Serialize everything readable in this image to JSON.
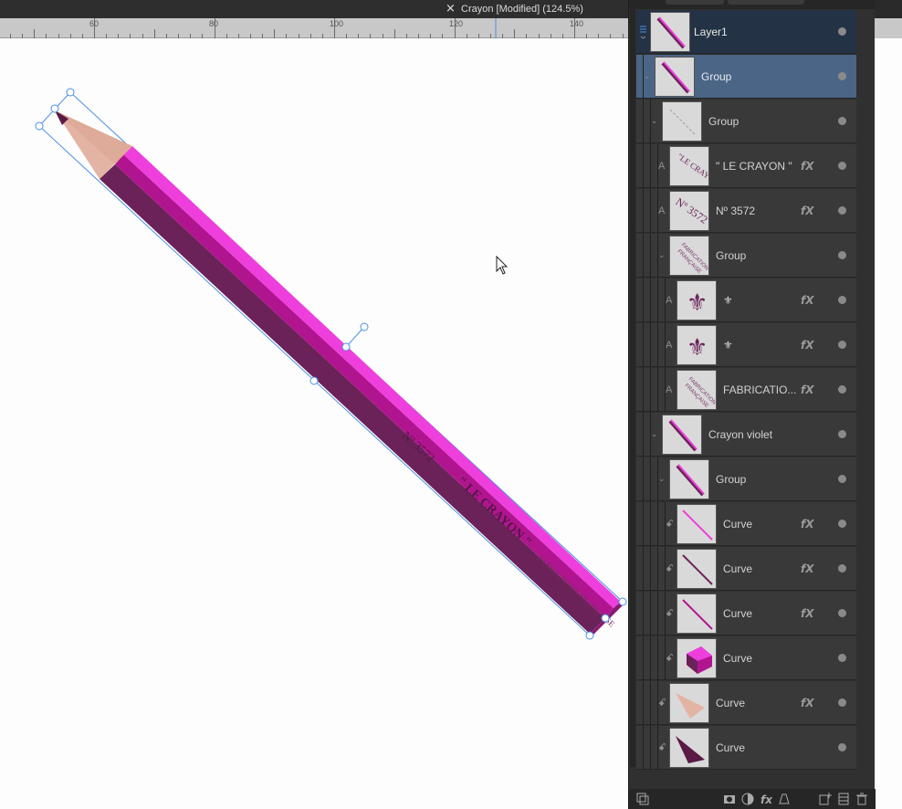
{
  "document_tab": {
    "title": "Crayon [Modified] (124.5%)",
    "close_glyph": "×"
  },
  "ruler": {
    "labels": [
      "60",
      "80",
      "100",
      "120",
      "140"
    ]
  },
  "canvas": {
    "pencil_text_number": "Nº 3572",
    "pencil_text_brand": "\" LE CRAYON \"",
    "pencil_text_origin": "FABRICATION FRANÇAISE",
    "colors": {
      "body_light": "#ee3fdd",
      "body_mid": "#b0158f",
      "body_dark": "#6b2258",
      "wood": "#e3b4a4",
      "lead": "#5a1a46",
      "selection": "#4a90e2"
    }
  },
  "layers_panel": {
    "layers": [
      {
        "name": "Layer1",
        "kind": "layer",
        "thumb": "pencil-thumb",
        "fx": ""
      },
      {
        "name": "Group",
        "kind": "group",
        "thumb": "pencil-thumb",
        "fx": ""
      },
      {
        "name": "Group",
        "kind": "group",
        "thumb": "line-thumb",
        "fx": ""
      },
      {
        "name": "\" LE CRAYON \"",
        "kind": "text",
        "thumb": "text-thumb",
        "fx": "fX"
      },
      {
        "name": "Nº 3572",
        "kind": "text",
        "thumb": "number-thumb",
        "fx": "fX"
      },
      {
        "name": "Group",
        "kind": "group",
        "thumb": "fabrication-thumb",
        "fx": ""
      },
      {
        "name": "⚜",
        "kind": "text",
        "thumb": "fleur-de-lis-thumb",
        "fx": "fX"
      },
      {
        "name": "⚜",
        "kind": "text",
        "thumb": "fleur-de-lis-thumb",
        "fx": "fX"
      },
      {
        "name": "FABRICATIO...",
        "kind": "text",
        "thumb": "fabrication-thumb",
        "fx": "fX"
      },
      {
        "name": "Crayon violet",
        "kind": "group",
        "thumb": "pencil-thumb",
        "fx": ""
      },
      {
        "name": "Group",
        "kind": "group",
        "thumb": "pencil-thumb",
        "fx": ""
      },
      {
        "name": "Curve",
        "kind": "curve",
        "thumb": "pink-line-thumb",
        "fx": "fX"
      },
      {
        "name": "Curve",
        "kind": "curve",
        "thumb": "dark-line-thumb",
        "fx": "fX"
      },
      {
        "name": "Curve",
        "kind": "curve",
        "thumb": "magenta-line-thumb",
        "fx": "fX"
      },
      {
        "name": "Curve",
        "kind": "curve",
        "thumb": "prism-thumb",
        "fx": ""
      },
      {
        "name": "Curve",
        "kind": "curve",
        "thumb": "wood-cone-thumb",
        "fx": "fX"
      },
      {
        "name": "Curve",
        "kind": "curve",
        "thumb": "lead-tip-thumb",
        "fx": ""
      }
    ],
    "type_markers": {
      "text": "A",
      "curve": "ꗃ",
      "expand": "⌄"
    }
  }
}
